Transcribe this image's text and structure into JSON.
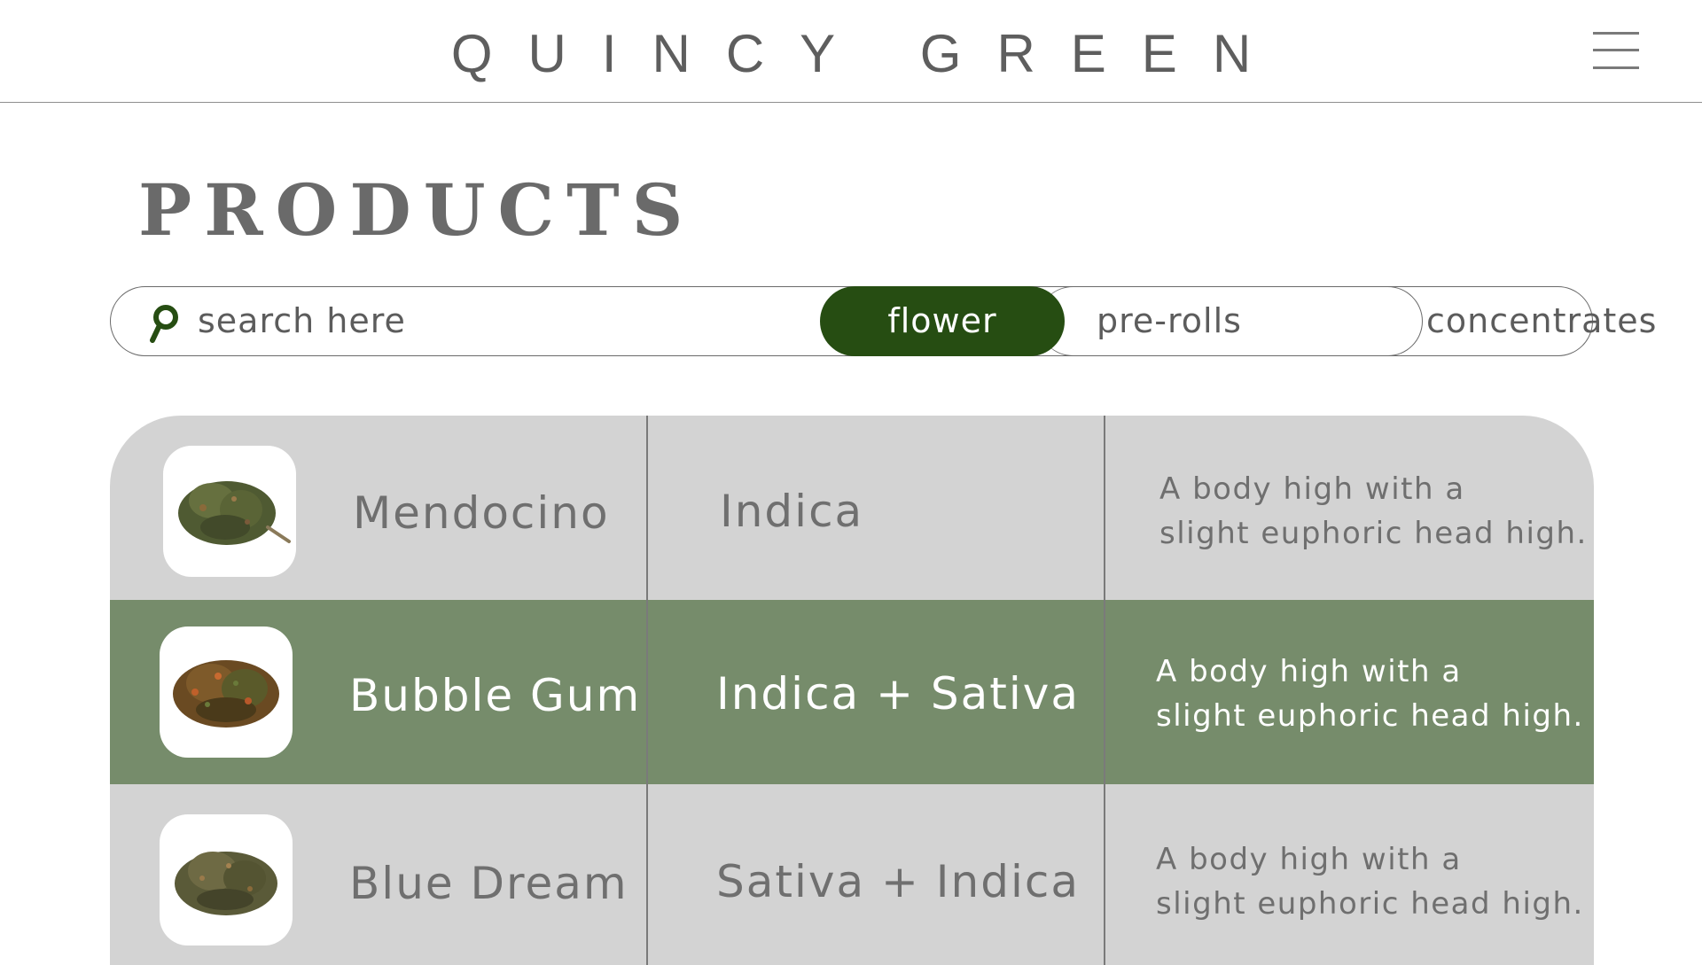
{
  "header": {
    "brand": "QUINCY GREEN",
    "menu_icon": "hamburger-menu-icon"
  },
  "page": {
    "title": "PRODUCTS"
  },
  "search": {
    "placeholder": "search here",
    "value": "",
    "icon": "search-icon"
  },
  "tabs": [
    {
      "label": "flower",
      "active": true
    },
    {
      "label": "pre-rolls",
      "active": false
    },
    {
      "label": "concentrates",
      "active": false
    }
  ],
  "products": [
    {
      "name": "Mendocino",
      "type": "Indica",
      "description_line1": "A body high with a",
      "description_line2": "slight euphoric head high.",
      "selected": false
    },
    {
      "name": "Bubble Gum",
      "type": "Indica + Sativa",
      "description_line1": "A body high with a",
      "description_line2": "slight euphoric head high.",
      "selected": true
    },
    {
      "name": "Blue Dream",
      "type": "Sativa + Indica",
      "description_line1": "A body high with a",
      "description_line2": "slight euphoric head high.",
      "selected": false
    }
  ],
  "colors": {
    "brand_green": "#264d12",
    "selected_row": "#768c6b",
    "row_gray": "#d3d3d3",
    "text_gray": "#6f6f6f"
  }
}
